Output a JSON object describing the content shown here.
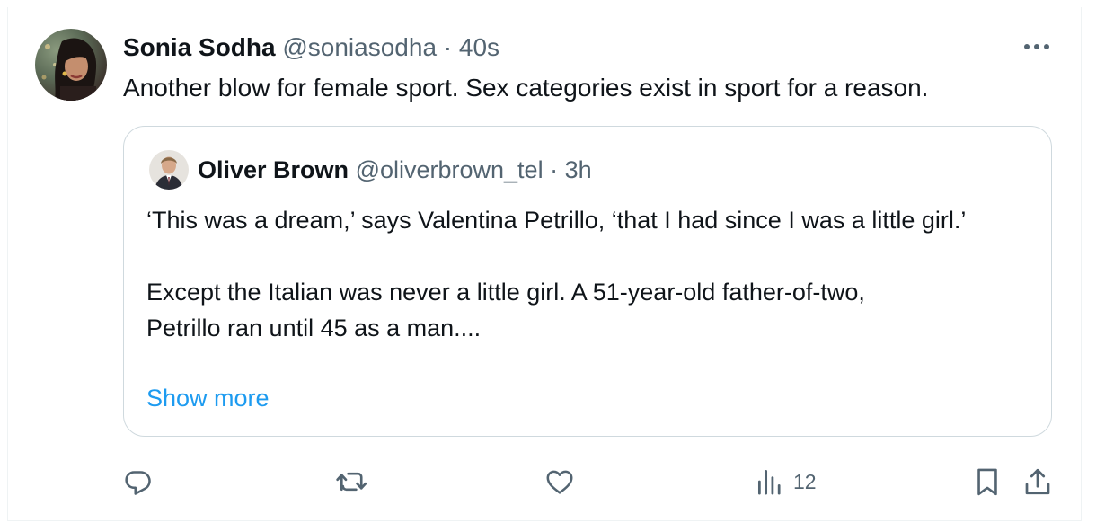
{
  "tweet": {
    "author_name": "Sonia Sodha",
    "handle": "@soniasodha",
    "separator": "·",
    "time": "40s",
    "text": "Another blow for female sport. Sex categories exist in sport for a reason."
  },
  "quoted": {
    "author_name": "Oliver Brown",
    "handle": "@oliverbrown_tel",
    "separator": "·",
    "time": "3h",
    "paragraph1": "‘This was a dream,’ says Valentina Petrillo, ‘that I had since I was a little girl.’",
    "paragraph2_line1": "Except the Italian was never a little girl. A 51-year-old father-of-two,",
    "paragraph2_line2": "Petrillo ran until 45 as a man....",
    "show_more": "Show more"
  },
  "actions": {
    "reply": {
      "icon": "reply-icon"
    },
    "retweet": {
      "icon": "retweet-icon"
    },
    "like": {
      "icon": "heart-icon"
    },
    "views": {
      "icon": "analytics-icon",
      "count": "12"
    },
    "bookmark": {
      "icon": "bookmark-icon"
    },
    "share": {
      "icon": "share-icon"
    }
  },
  "colors": {
    "text": "#0f1419",
    "secondary": "#536471",
    "link": "#1d9bf0",
    "border": "#cfd9de"
  }
}
